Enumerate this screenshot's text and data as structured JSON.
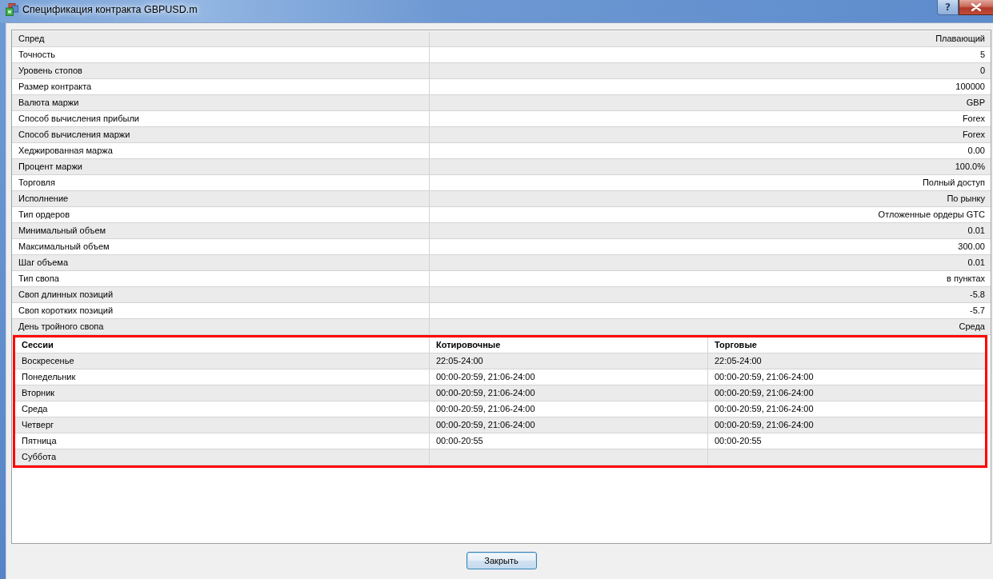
{
  "window": {
    "title": "Спецификация контракта GBPUSD.m",
    "help_label": "?"
  },
  "specs": [
    {
      "label": "Спред",
      "value": "Плавающий"
    },
    {
      "label": "Точность",
      "value": "5"
    },
    {
      "label": "Уровень стопов",
      "value": "0"
    },
    {
      "label": "Размер контракта",
      "value": "100000"
    },
    {
      "label": "Валюта маржи",
      "value": "GBP"
    },
    {
      "label": "Способ вычисления прибыли",
      "value": "Forex"
    },
    {
      "label": "Способ вычисления маржи",
      "value": "Forex"
    },
    {
      "label": "Хеджированная маржа",
      "value": "0.00"
    },
    {
      "label": "Процент маржи",
      "value": "100.0%"
    },
    {
      "label": "Торговля",
      "value": "Полный доступ"
    },
    {
      "label": "Исполнение",
      "value": "По рынку"
    },
    {
      "label": "Тип ордеров",
      "value": "Отложенные ордеры GTC"
    },
    {
      "label": "Минимальный объем",
      "value": "0.01"
    },
    {
      "label": "Максимальный объем",
      "value": "300.00"
    },
    {
      "label": "Шаг объема",
      "value": "0.01"
    },
    {
      "label": "Тип свопа",
      "value": "в пунктах"
    },
    {
      "label": "Своп длинных позиций",
      "value": "-5.8"
    },
    {
      "label": "Своп коротких позиций",
      "value": "-5.7"
    },
    {
      "label": "День тройного свопа",
      "value": "Среда"
    }
  ],
  "sessions": {
    "highlighted": true,
    "columns": [
      "Сессии",
      "Котировочные",
      "Торговые"
    ],
    "rows": [
      {
        "day": "Воскресенье",
        "quotes": "22:05-24:00",
        "trades": "22:05-24:00"
      },
      {
        "day": "Понедельник",
        "quotes": "00:00-20:59, 21:06-24:00",
        "trades": "00:00-20:59, 21:06-24:00"
      },
      {
        "day": "Вторник",
        "quotes": "00:00-20:59, 21:06-24:00",
        "trades": "00:00-20:59, 21:06-24:00"
      },
      {
        "day": "Среда",
        "quotes": "00:00-20:59, 21:06-24:00",
        "trades": "00:00-20:59, 21:06-24:00"
      },
      {
        "day": "Четверг",
        "quotes": "00:00-20:59, 21:06-24:00",
        "trades": "00:00-20:59, 21:06-24:00"
      },
      {
        "day": "Пятница",
        "quotes": "00:00-20:55",
        "trades": "00:00-20:55"
      },
      {
        "day": "Суббота"
      }
    ]
  },
  "buttons": [
    "Закрыть"
  ]
}
